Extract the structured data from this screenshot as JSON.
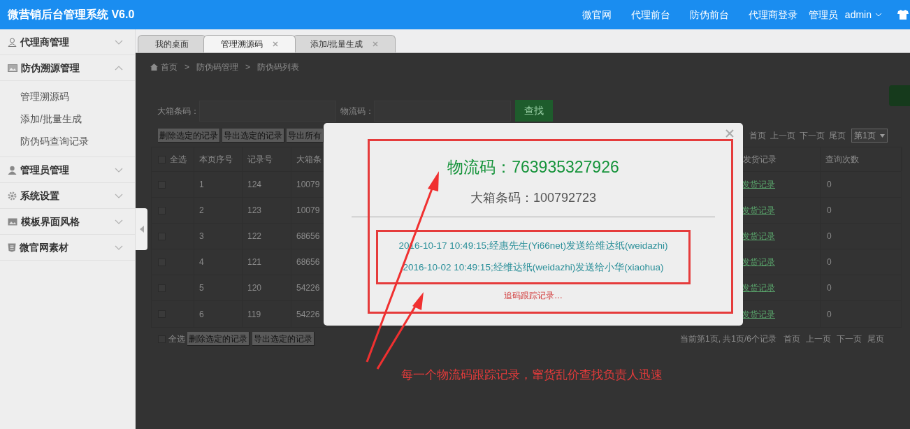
{
  "header": {
    "title": "微营销后台管理系统 V6.0",
    "nav": [
      "微官网",
      "代理前台",
      "防伪前台",
      "代理商登录"
    ],
    "user_label": "管理员",
    "user_name": "admin"
  },
  "sidebar": {
    "groups": [
      {
        "label": "代理商管理",
        "expanded": false
      },
      {
        "label": "防伪溯源管理",
        "expanded": true,
        "children": [
          "管理溯源码",
          "添加/批量生成",
          "防伪码查询记录"
        ]
      },
      {
        "label": "管理员管理",
        "expanded": false
      },
      {
        "label": "系统设置",
        "expanded": false
      },
      {
        "label": "模板界面风格",
        "expanded": false
      },
      {
        "label": "微官网素材",
        "expanded": false
      }
    ]
  },
  "tabs": [
    {
      "label": "我的桌面",
      "selected": false,
      "closable": false
    },
    {
      "label": "管理溯源码",
      "selected": true,
      "closable": true
    },
    {
      "label": "添加/批量生成",
      "selected": false,
      "closable": true
    }
  ],
  "breadcrumb": {
    "separator": ">",
    "items": [
      "首页",
      "防伪码管理",
      "防伪码列表"
    ]
  },
  "filter": {
    "fields": [
      {
        "label": "大箱条码："
      },
      {
        "label": "物流码："
      }
    ],
    "search_button": "查找"
  },
  "toolbar": [
    "删除选定的记录",
    "导出选定的记录",
    "导出所有"
  ],
  "pager_top": {
    "links": [
      "首页",
      "上一页",
      "下一页",
      "尾页"
    ],
    "page_select": "第1页"
  },
  "table": {
    "select_all": {
      "label": "全选",
      "checked": false
    },
    "columns": [
      "本页序号",
      "记录号",
      "大箱条",
      "发货记录",
      "查询次数"
    ],
    "rows": [
      {
        "checked": false,
        "cells": [
          "1",
          "124",
          "10079"
        ],
        "link": "发货记录",
        "count": "0"
      },
      {
        "checked": false,
        "cells": [
          "2",
          "123",
          "10079"
        ],
        "link": "发货记录",
        "count": "0"
      },
      {
        "checked": false,
        "cells": [
          "3",
          "122",
          "68656"
        ],
        "link": "发货记录",
        "count": "0"
      },
      {
        "checked": false,
        "cells": [
          "4",
          "121",
          "68656"
        ],
        "link": "发货记录",
        "count": "0"
      },
      {
        "checked": false,
        "cells": [
          "5",
          "120",
          "54226"
        ],
        "link": "发货记录",
        "count": "0"
      },
      {
        "checked": false,
        "cells": [
          "6",
          "119",
          "54226"
        ],
        "link": "发货记录",
        "count": "0"
      }
    ]
  },
  "footer": {
    "select_all": {
      "label": "全选",
      "checked": false
    },
    "buttons": [
      "删除选定的记录",
      "导出选定的记录"
    ],
    "summary": "当前第1页, 共1页/6个记录",
    "links": [
      "首页",
      "上一页",
      "下一页",
      "尾页"
    ]
  },
  "modal": {
    "title": "物流码：763935327926",
    "box_code": "大箱条码：100792723",
    "records": [
      "2016-10-17 10:49:15;经惠先生(Yi66net)发送给维达纸(weidazhi)",
      "2016-10-02 10:49:15;经维达纸(weidazhi)发送给小华(xiaohua)"
    ],
    "more": "追码跟踪记录…"
  },
  "annotation": {
    "text": "每一个物流码跟踪记录，窜货乱价查找负责人迅速"
  }
}
